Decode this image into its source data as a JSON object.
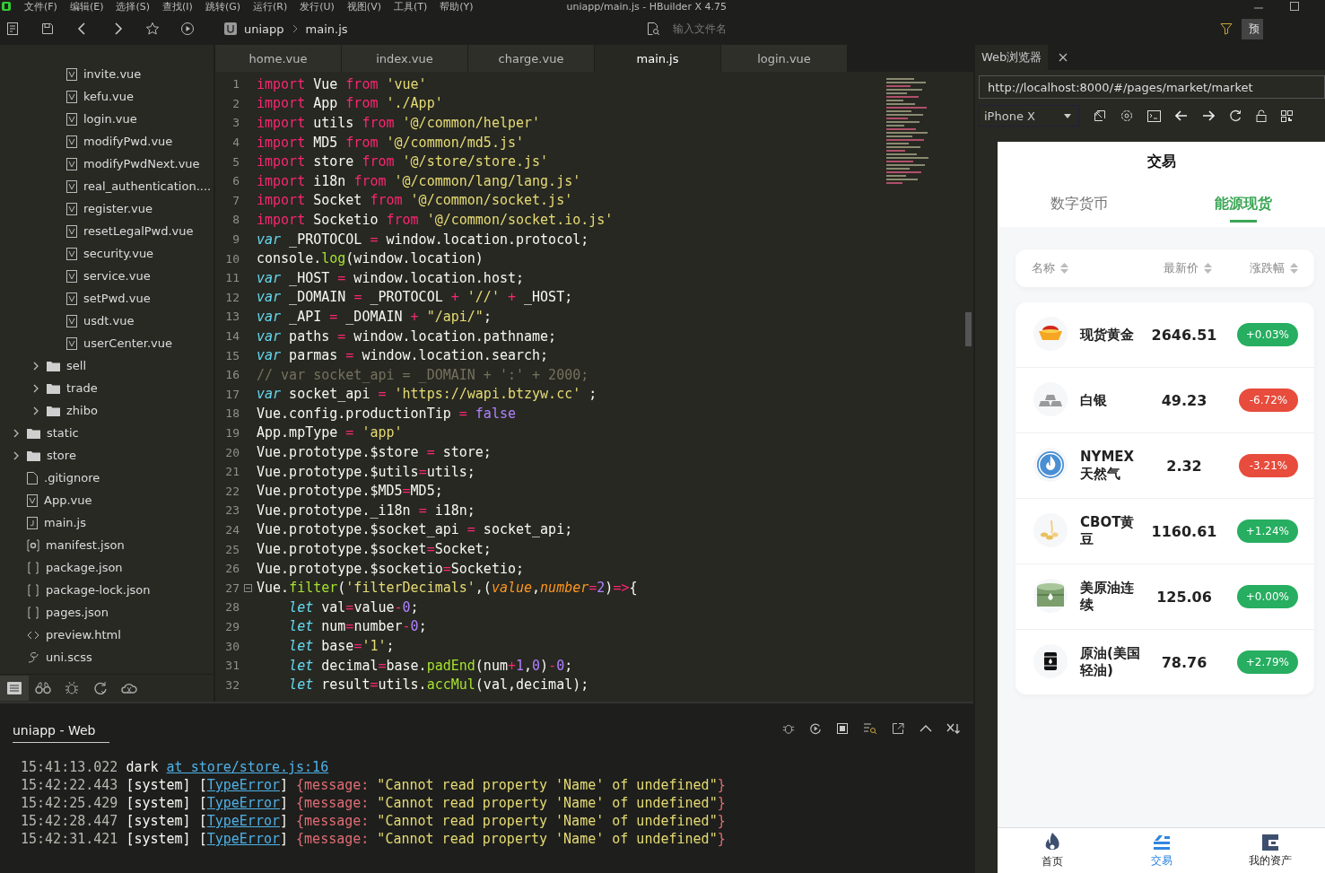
{
  "window": {
    "title": "uniapp/main.js - HBuilder X 4.75"
  },
  "menu_bar": [
    "文件(F)",
    "编辑(E)",
    "选择(S)",
    "查找(I)",
    "跳转(G)",
    "运行(R)",
    "发行(U)",
    "视图(V)",
    "工具(T)",
    "帮助(Y)"
  ],
  "toolbar": {
    "breadcrumb": [
      "uniapp",
      "main.js"
    ],
    "file_search": {
      "placeholder": "输入文件名"
    },
    "preview_button": "预"
  },
  "sidebar": {
    "tree": [
      {
        "children": [
          {
            "children": [
              {
                "label": "invite.vue",
                "kind": "vue"
              },
              {
                "label": "kefu.vue",
                "kind": "vue"
              },
              {
                "label": "login.vue",
                "kind": "vue"
              },
              {
                "label": "modifyPwd.vue",
                "kind": "vue"
              },
              {
                "label": "modifyPwdNext.vue",
                "kind": "vue"
              },
              {
                "label": "real_authentication....",
                "kind": "vue"
              },
              {
                "label": "register.vue",
                "kind": "vue"
              },
              {
                "label": "resetLegalPwd.vue",
                "kind": "vue"
              },
              {
                "label": "security.vue",
                "kind": "vue"
              },
              {
                "label": "service.vue",
                "kind": "vue"
              },
              {
                "label": "setPwd.vue",
                "kind": "vue"
              },
              {
                "label": "usdt.vue",
                "kind": "vue"
              },
              {
                "label": "userCenter.vue",
                "kind": "vue"
              }
            ]
          },
          {
            "label": "sell",
            "kind": "folder",
            "expanded": false
          },
          {
            "label": "trade",
            "kind": "folder",
            "expanded": false
          },
          {
            "label": "zhibo",
            "kind": "folder",
            "expanded": false
          }
        ]
      },
      {
        "label": "static",
        "kind": "folder",
        "expanded": false
      },
      {
        "label": "store",
        "kind": "folder",
        "expanded": false
      },
      {
        "label": ".gitignore",
        "kind": "file"
      },
      {
        "label": "App.vue",
        "kind": "vue"
      },
      {
        "label": "main.js",
        "kind": "js"
      },
      {
        "label": "manifest.json",
        "kind": "manifest"
      },
      {
        "label": "package.json",
        "kind": "json"
      },
      {
        "label": "package-lock.json",
        "kind": "json"
      },
      {
        "label": "pages.json",
        "kind": "json"
      },
      {
        "label": "preview.html",
        "kind": "html"
      },
      {
        "label": "uni.scss",
        "kind": "scss"
      }
    ],
    "bottom_tabs": [
      {
        "kind": "files",
        "selected": true
      },
      {
        "kind": "binoculars",
        "selected": false
      },
      {
        "kind": "bug",
        "selected": false
      },
      {
        "kind": "refresh",
        "selected": false
      },
      {
        "kind": "cloud",
        "selected": false
      }
    ]
  },
  "editor": {
    "tabs": [
      {
        "label": "home.vue",
        "selected": false
      },
      {
        "label": "index.vue",
        "selected": false
      },
      {
        "label": "charge.vue",
        "selected": false
      },
      {
        "label": "main.js",
        "selected": true
      },
      {
        "label": "login.vue",
        "selected": false
      }
    ],
    "lines": [
      {
        "number": "1",
        "foldable": false,
        "tokens": [
          {
            "kind": "kw",
            "text": "import"
          },
          {
            "kind": "pl",
            "text": " Vue "
          },
          {
            "kind": "kw",
            "text": "from"
          },
          {
            "kind": "str",
            "text": " 'vue'"
          }
        ]
      },
      {
        "number": "2",
        "foldable": false,
        "tokens": [
          {
            "kind": "kw",
            "text": "import"
          },
          {
            "kind": "pl",
            "text": " App "
          },
          {
            "kind": "kw",
            "text": "from"
          },
          {
            "kind": "str",
            "text": " './App'"
          }
        ]
      },
      {
        "number": "3",
        "foldable": false,
        "tokens": [
          {
            "kind": "kw",
            "text": "import"
          },
          {
            "kind": "pl",
            "text": " utils "
          },
          {
            "kind": "kw",
            "text": "from"
          },
          {
            "kind": "str",
            "text": " '@/common/helper'"
          }
        ]
      },
      {
        "number": "4",
        "foldable": false,
        "tokens": [
          {
            "kind": "kw",
            "text": "import"
          },
          {
            "kind": "pl",
            "text": " MD5 "
          },
          {
            "kind": "kw",
            "text": "from"
          },
          {
            "kind": "str",
            "text": " '@/common/md5.js'"
          }
        ]
      },
      {
        "number": "5",
        "foldable": false,
        "tokens": [
          {
            "kind": "kw",
            "text": "import"
          },
          {
            "kind": "pl",
            "text": " store "
          },
          {
            "kind": "kw",
            "text": "from"
          },
          {
            "kind": "str",
            "text": " '@/store/store.js'"
          }
        ]
      },
      {
        "number": "6",
        "foldable": false,
        "tokens": [
          {
            "kind": "kw",
            "text": "import"
          },
          {
            "kind": "pl",
            "text": " i18n "
          },
          {
            "kind": "kw",
            "text": "from"
          },
          {
            "kind": "str",
            "text": " '@/common/lang/lang.js'"
          }
        ]
      },
      {
        "number": "7",
        "foldable": false,
        "tokens": [
          {
            "kind": "kw",
            "text": "import"
          },
          {
            "kind": "pl",
            "text": " Socket "
          },
          {
            "kind": "kw",
            "text": "from"
          },
          {
            "kind": "str",
            "text": " '@/common/socket.js'"
          }
        ]
      },
      {
        "number": "8",
        "foldable": false,
        "tokens": [
          {
            "kind": "kw",
            "text": "import"
          },
          {
            "kind": "pl",
            "text": " Socketio "
          },
          {
            "kind": "kw",
            "text": "from"
          },
          {
            "kind": "str",
            "text": " '@/common/socket.io.js'"
          }
        ]
      },
      {
        "number": "9",
        "foldable": false,
        "tokens": [
          {
            "kind": "decl",
            "text": "var"
          },
          {
            "kind": "pl",
            "text": " _PROTOCOL "
          },
          {
            "kind": "op",
            "text": "="
          },
          {
            "kind": "pl",
            "text": " window.location.protocol;"
          }
        ]
      },
      {
        "number": "10",
        "foldable": false,
        "tokens": [
          {
            "kind": "pl",
            "text": "console."
          },
          {
            "kind": "fn",
            "text": "log"
          },
          {
            "kind": "pl",
            "text": "(window.location)"
          }
        ]
      },
      {
        "number": "11",
        "foldable": false,
        "tokens": [
          {
            "kind": "decl",
            "text": "var"
          },
          {
            "kind": "pl",
            "text": " _HOST "
          },
          {
            "kind": "op",
            "text": "="
          },
          {
            "kind": "pl",
            "text": " window.location.host;"
          }
        ]
      },
      {
        "number": "12",
        "foldable": false,
        "tokens": [
          {
            "kind": "decl",
            "text": "var"
          },
          {
            "kind": "pl",
            "text": " _DOMAIN "
          },
          {
            "kind": "op",
            "text": "="
          },
          {
            "kind": "pl",
            "text": " _PROTOCOL "
          },
          {
            "kind": "op",
            "text": "+"
          },
          {
            "kind": "str",
            "text": " '//' "
          },
          {
            "kind": "op",
            "text": "+"
          },
          {
            "kind": "pl",
            "text": " _HOST;"
          }
        ]
      },
      {
        "number": "13",
        "foldable": false,
        "tokens": [
          {
            "kind": "decl",
            "text": "var"
          },
          {
            "kind": "pl",
            "text": " _API "
          },
          {
            "kind": "op",
            "text": "="
          },
          {
            "kind": "pl",
            "text": " _DOMAIN "
          },
          {
            "kind": "op",
            "text": "+"
          },
          {
            "kind": "str",
            "text": " \"/api/\""
          },
          {
            "kind": "pl",
            "text": ";"
          }
        ]
      },
      {
        "number": "14",
        "foldable": false,
        "tokens": [
          {
            "kind": "decl",
            "text": "var"
          },
          {
            "kind": "pl",
            "text": " paths "
          },
          {
            "kind": "op",
            "text": "="
          },
          {
            "kind": "pl",
            "text": " window.location.pathname;"
          }
        ]
      },
      {
        "number": "15",
        "foldable": false,
        "tokens": [
          {
            "kind": "decl",
            "text": "var"
          },
          {
            "kind": "pl",
            "text": " parmas "
          },
          {
            "kind": "op",
            "text": "="
          },
          {
            "kind": "pl",
            "text": " window.location.search;"
          }
        ]
      },
      {
        "number": "16",
        "foldable": false,
        "tokens": [
          {
            "kind": "cm",
            "text": "// var socket_api = _DOMAIN + ':' + 2000;"
          }
        ]
      },
      {
        "number": "17",
        "foldable": false,
        "tokens": [
          {
            "kind": "decl",
            "text": "var"
          },
          {
            "kind": "pl",
            "text": " socket_api "
          },
          {
            "kind": "op",
            "text": "="
          },
          {
            "kind": "str",
            "text": " 'https://wapi.btzyw.cc'"
          },
          {
            "kind": "pl",
            "text": " ;"
          }
        ]
      },
      {
        "number": "18",
        "foldable": false,
        "tokens": [
          {
            "kind": "pl",
            "text": "Vue.config.productionTip "
          },
          {
            "kind": "op",
            "text": "="
          },
          {
            "kind": "num",
            "text": " false"
          }
        ]
      },
      {
        "number": "19",
        "foldable": false,
        "tokens": [
          {
            "kind": "pl",
            "text": "App.mpType "
          },
          {
            "kind": "op",
            "text": "="
          },
          {
            "kind": "str",
            "text": " 'app'"
          }
        ]
      },
      {
        "number": "20",
        "foldable": false,
        "tokens": [
          {
            "kind": "pl",
            "text": "Vue.prototype.$store "
          },
          {
            "kind": "op",
            "text": "="
          },
          {
            "kind": "pl",
            "text": " store;"
          }
        ]
      },
      {
        "number": "21",
        "foldable": false,
        "tokens": [
          {
            "kind": "pl",
            "text": "Vue.prototype.$utils"
          },
          {
            "kind": "op",
            "text": "="
          },
          {
            "kind": "pl",
            "text": "utils;"
          }
        ]
      },
      {
        "number": "22",
        "foldable": false,
        "tokens": [
          {
            "kind": "pl",
            "text": "Vue.prototype.$MD5"
          },
          {
            "kind": "op",
            "text": "="
          },
          {
            "kind": "pl",
            "text": "MD5;"
          }
        ]
      },
      {
        "number": "23",
        "foldable": false,
        "tokens": [
          {
            "kind": "pl",
            "text": "Vue.prototype._i18n "
          },
          {
            "kind": "op",
            "text": "="
          },
          {
            "kind": "pl",
            "text": " i18n;"
          }
        ]
      },
      {
        "number": "24",
        "foldable": false,
        "tokens": [
          {
            "kind": "pl",
            "text": "Vue.prototype.$socket_api "
          },
          {
            "kind": "op",
            "text": "="
          },
          {
            "kind": "pl",
            "text": " socket_api;"
          }
        ]
      },
      {
        "number": "25",
        "foldable": false,
        "tokens": [
          {
            "kind": "pl",
            "text": "Vue.prototype.$socket"
          },
          {
            "kind": "op",
            "text": "="
          },
          {
            "kind": "pl",
            "text": "Socket;"
          }
        ]
      },
      {
        "number": "26",
        "foldable": false,
        "tokens": [
          {
            "kind": "pl",
            "text": "Vue.prototype.$socketio"
          },
          {
            "kind": "op",
            "text": "="
          },
          {
            "kind": "pl",
            "text": "Socketio;"
          }
        ]
      },
      {
        "number": "27",
        "foldable": true,
        "tokens": [
          {
            "kind": "pl",
            "text": "Vue."
          },
          {
            "kind": "fn",
            "text": "filter"
          },
          {
            "kind": "pl",
            "text": "("
          },
          {
            "kind": "str",
            "text": "'filterDecimals'"
          },
          {
            "kind": "pl",
            "text": ",("
          },
          {
            "kind": "arg",
            "text": "value"
          },
          {
            "kind": "pl",
            "text": ","
          },
          {
            "kind": "arg",
            "text": "number"
          },
          {
            "kind": "op",
            "text": "="
          },
          {
            "kind": "num",
            "text": "2"
          },
          {
            "kind": "pl",
            "text": ")"
          },
          {
            "kind": "op",
            "text": "=>"
          },
          {
            "kind": "pl",
            "text": "{"
          }
        ]
      },
      {
        "number": "28",
        "foldable": false,
        "tokens": [
          {
            "kind": "decl",
            "text": "    let"
          },
          {
            "kind": "pl",
            "text": " val"
          },
          {
            "kind": "op",
            "text": "="
          },
          {
            "kind": "pl",
            "text": "value"
          },
          {
            "kind": "op",
            "text": "-"
          },
          {
            "kind": "num",
            "text": "0"
          },
          {
            "kind": "pl",
            "text": ";"
          }
        ]
      },
      {
        "number": "29",
        "foldable": false,
        "tokens": [
          {
            "kind": "decl",
            "text": "    let"
          },
          {
            "kind": "pl",
            "text": " num"
          },
          {
            "kind": "op",
            "text": "="
          },
          {
            "kind": "pl",
            "text": "number"
          },
          {
            "kind": "op",
            "text": "-"
          },
          {
            "kind": "num",
            "text": "0"
          },
          {
            "kind": "pl",
            "text": ";"
          }
        ]
      },
      {
        "number": "30",
        "foldable": false,
        "tokens": [
          {
            "kind": "decl",
            "text": "    let"
          },
          {
            "kind": "pl",
            "text": " base"
          },
          {
            "kind": "op",
            "text": "="
          },
          {
            "kind": "str",
            "text": "'1'"
          },
          {
            "kind": "pl",
            "text": ";"
          }
        ]
      },
      {
        "number": "31",
        "foldable": false,
        "tokens": [
          {
            "kind": "decl",
            "text": "    let"
          },
          {
            "kind": "pl",
            "text": " decimal"
          },
          {
            "kind": "op",
            "text": "="
          },
          {
            "kind": "pl",
            "text": "base."
          },
          {
            "kind": "fn",
            "text": "padEnd"
          },
          {
            "kind": "pl",
            "text": "(num"
          },
          {
            "kind": "op",
            "text": "+"
          },
          {
            "kind": "num",
            "text": "1"
          },
          {
            "kind": "pl",
            "text": ","
          },
          {
            "kind": "num",
            "text": "0"
          },
          {
            "kind": "pl",
            "text": ")"
          },
          {
            "kind": "op",
            "text": "-"
          },
          {
            "kind": "num",
            "text": "0"
          },
          {
            "kind": "pl",
            "text": ";"
          }
        ]
      },
      {
        "number": "32",
        "foldable": false,
        "tokens": [
          {
            "kind": "decl",
            "text": "    let"
          },
          {
            "kind": "pl",
            "text": " result"
          },
          {
            "kind": "op",
            "text": "="
          },
          {
            "kind": "pl",
            "text": "utils."
          },
          {
            "kind": "fn",
            "text": "accMul"
          },
          {
            "kind": "pl",
            "text": "(val,decimal);"
          }
        ]
      }
    ]
  },
  "console": {
    "tab": {
      "label": "uniapp - Web",
      "selected": true
    },
    "lines": [
      [
        {
          "kind": "ts",
          "text": "15:41:13.022"
        },
        {
          "kind": "pl",
          "text": " dark "
        },
        {
          "kind": "link",
          "text": "at store/store.js:16"
        }
      ],
      [
        {
          "kind": "ts",
          "text": "15:42:22.443"
        },
        {
          "kind": "pl",
          "text": " [system] ["
        },
        {
          "kind": "link",
          "text": "TypeError"
        },
        {
          "kind": "pl",
          "text": "] "
        },
        {
          "kind": "br",
          "text": "{message:"
        },
        {
          "kind": "str",
          "text": " \"Cannot read property 'Name' of undefined\""
        },
        {
          "kind": "br",
          "text": "}"
        }
      ],
      [
        {
          "kind": "ts",
          "text": "15:42:25.429"
        },
        {
          "kind": "pl",
          "text": " [system] ["
        },
        {
          "kind": "link",
          "text": "TypeError"
        },
        {
          "kind": "pl",
          "text": "] "
        },
        {
          "kind": "br",
          "text": "{message:"
        },
        {
          "kind": "str",
          "text": " \"Cannot read property 'Name' of undefined\""
        },
        {
          "kind": "br",
          "text": "}"
        }
      ],
      [
        {
          "kind": "ts",
          "text": "15:42:28.447"
        },
        {
          "kind": "pl",
          "text": " [system] ["
        },
        {
          "kind": "link",
          "text": "TypeError"
        },
        {
          "kind": "pl",
          "text": "] "
        },
        {
          "kind": "br",
          "text": "{message:"
        },
        {
          "kind": "str",
          "text": " \"Cannot read property 'Name' of undefined\""
        },
        {
          "kind": "br",
          "text": "}"
        }
      ],
      [
        {
          "kind": "ts",
          "text": "15:42:31.421"
        },
        {
          "kind": "pl",
          "text": " [system] ["
        },
        {
          "kind": "link",
          "text": "TypeError"
        },
        {
          "kind": "pl",
          "text": "] "
        },
        {
          "kind": "br",
          "text": "{message:"
        },
        {
          "kind": "str",
          "text": " \"Cannot read property 'Name' of undefined\""
        },
        {
          "kind": "br",
          "text": "}"
        }
      ]
    ]
  },
  "browser": {
    "tab": {
      "label": "Web浏览器"
    },
    "url": "http://localhost:8000/#/pages/market/market",
    "device": "iPhone X",
    "phone": {
      "title": "交易",
      "tabs": [
        {
          "label": "数字货币",
          "selected": false
        },
        {
          "label": "能源现货",
          "selected": true
        }
      ],
      "columns": [
        "名称",
        "最新价",
        "涨跌幅"
      ],
      "rows": [
        {
          "kind": "gold",
          "name": "现货黄金",
          "price": "2646.51",
          "change": "+0.03%",
          "color": "#27ae60"
        },
        {
          "kind": "silver",
          "name": "白银",
          "price": "49.23",
          "change": "-6.72%",
          "color": "#e74c3c"
        },
        {
          "kind": "gas",
          "name": "NYMEX天然气",
          "price": "2.32",
          "change": "-3.21%",
          "color": "#e74c3c"
        },
        {
          "kind": "beans",
          "name": "CBOT黄豆",
          "price": "1160.61",
          "change": "+1.24%",
          "color": "#27ae60"
        },
        {
          "kind": "oil_green",
          "name": "美原油连续",
          "price": "125.06",
          "change": "+0.00%",
          "color": "#27ae60"
        },
        {
          "kind": "oil_black",
          "name": "原油(美国轻油)",
          "price": "78.76",
          "change": "+2.79%",
          "color": "#27ae60"
        }
      ],
      "nav": [
        {
          "kind": "home",
          "label": "首页",
          "selected": false
        },
        {
          "kind": "trade",
          "label": "交易",
          "selected": true
        },
        {
          "kind": "assets",
          "label": "我的资产",
          "selected": false
        }
      ]
    }
  }
}
